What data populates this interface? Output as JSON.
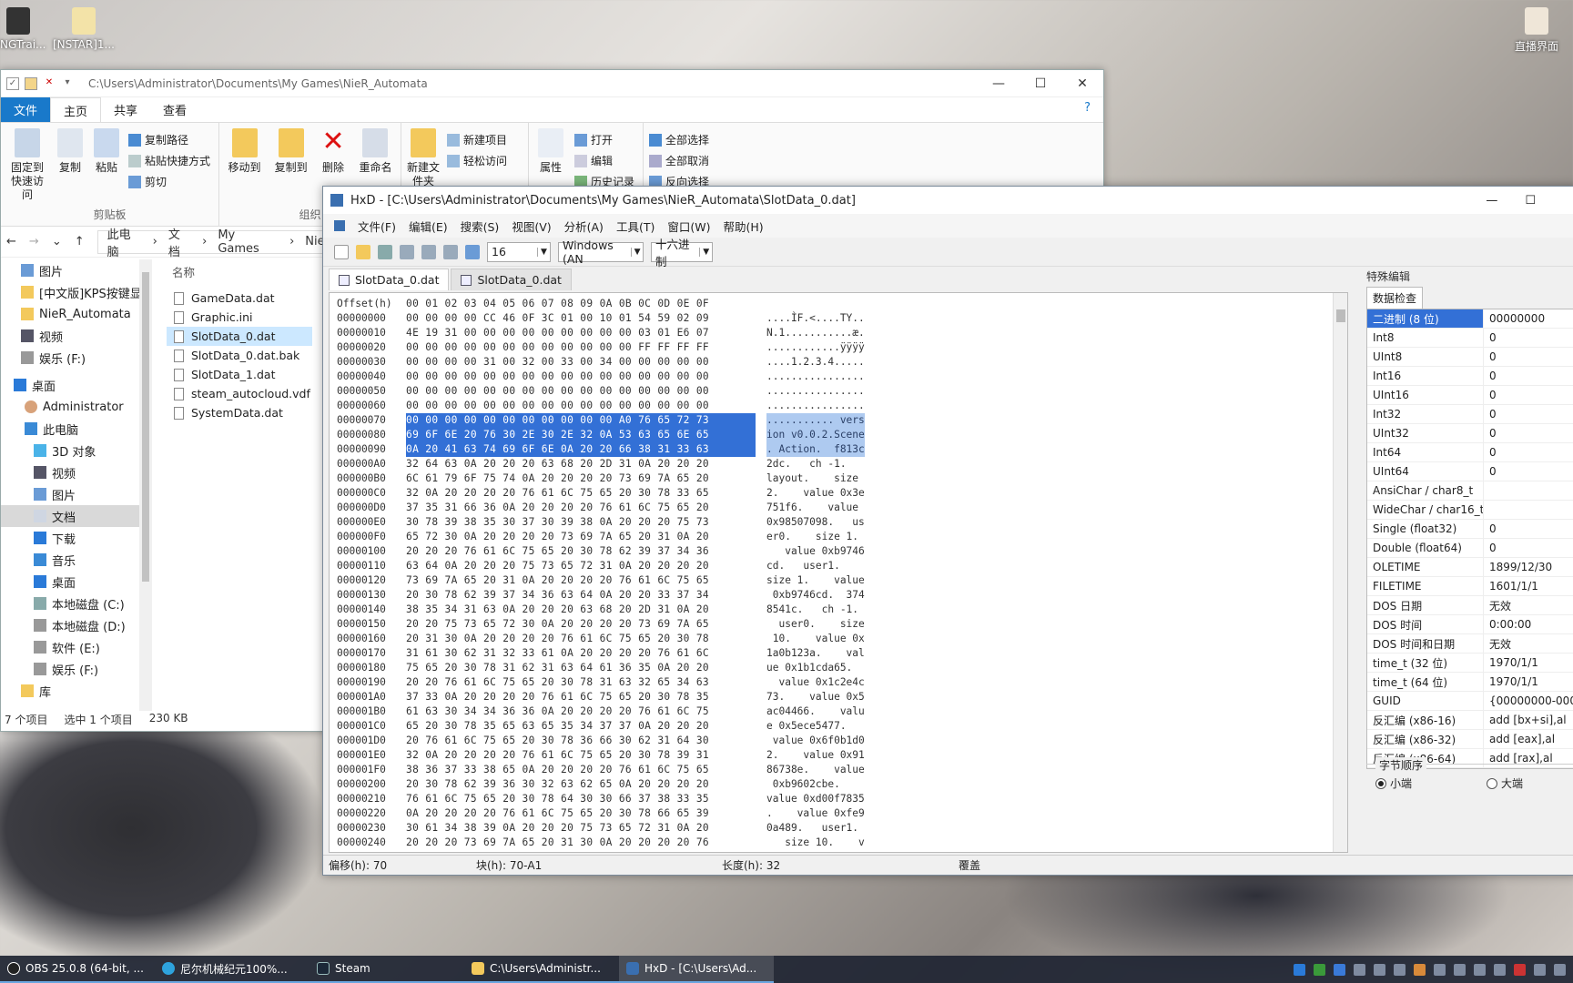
{
  "desktop": {
    "icons": [
      {
        "label": "NGTrai..."
      },
      {
        "label": "[NSTAR]1..."
      },
      {
        "label": "直播界面"
      }
    ]
  },
  "explorer": {
    "path": "C:\\Users\\Administrator\\Documents\\My Games\\NieR_Automata",
    "tabs": [
      "文件",
      "主页",
      "共享",
      "查看"
    ],
    "ribbon": {
      "pin": "固定到快速访问",
      "copy": "复制",
      "paste": "粘贴",
      "copy_path": "复制路径",
      "paste_shortcut": "粘贴快捷方式",
      "cut": "剪切",
      "clipboard_group": "剪贴板",
      "move_to": "移动到",
      "copy_to": "复制到",
      "delete": "删除",
      "rename": "重命名",
      "organize_group": "组织",
      "new_folder": "新建文件夹",
      "new_item": "新建项目",
      "easy_access": "轻松访问",
      "properties": "属性",
      "open": "打开",
      "edit": "编辑",
      "history": "历史记录",
      "select_all": "全部选择",
      "select_none": "全部取消",
      "invert": "反向选择"
    },
    "breadcrumb": [
      "此电脑",
      "文档",
      "My Games",
      "NieR"
    ],
    "nav": [
      "图片",
      "[中文版]KPS按键显示",
      "NieR_Automata",
      "视频",
      "娱乐 (F:)",
      "桌面",
      "Administrator",
      "此电脑",
      "3D 对象",
      "视频",
      "图片",
      "文档",
      "下载",
      "音乐",
      "桌面",
      "本地磁盘 (C:)",
      "本地磁盘 (D:)",
      "软件 (E:)",
      "娱乐 (F:)",
      "库"
    ],
    "column_name": "名称",
    "files": [
      "GameData.dat",
      "Graphic.ini",
      "SlotData_0.dat",
      "SlotData_0.dat.bak",
      "SlotData_1.dat",
      "steam_autocloud.vdf",
      "SystemData.dat"
    ],
    "status": {
      "count": "7 个项目",
      "selected": "选中 1 个项目",
      "size": "230 KB"
    }
  },
  "hxd": {
    "title": "HxD - [C:\\Users\\Administrator\\Documents\\My Games\\NieR_Automata\\SlotData_0.dat]",
    "menu": [
      "文件(F)",
      "编辑(E)",
      "搜索(S)",
      "视图(V)",
      "分析(A)",
      "工具(T)",
      "窗口(W)",
      "帮助(H)"
    ],
    "bytes_per_row": "16",
    "charset": "Windows (AN",
    "base": "十六进制",
    "doc_tabs": [
      "SlotData_0.dat",
      "SlotData_0.dat"
    ],
    "header": {
      "offset": "Offset(h)",
      "cols": "00 01 02 03 04 05 06 07 08 09 0A 0B 0C 0D 0E 0F"
    },
    "rows": [
      [
        "00000000",
        "00 00 00 00 CC 46 0F 3C 01 00 10 01 54 59 02 09",
        "....ÌF.<....TY.."
      ],
      [
        "00000010",
        "4E 19 31 00 00 00 00 00 00 00 00 00 03 01 E6 07",
        "N.1...........æ."
      ],
      [
        "00000020",
        "00 00 00 00 00 00 00 00 00 00 00 00 FF FF FF FF",
        "............ÿÿÿÿ"
      ],
      [
        "00000030",
        "00 00 00 00 31 00 32 00 33 00 34 00 00 00 00 00",
        "....1.2.3.4....."
      ],
      [
        "00000040",
        "00 00 00 00 00 00 00 00 00 00 00 00 00 00 00 00",
        "................"
      ],
      [
        "00000050",
        "00 00 00 00 00 00 00 00 00 00 00 00 00 00 00 00",
        "................"
      ],
      [
        "00000060",
        "00 00 00 00 00 00 00 00 00 00 00 00 00 00 00 00",
        "................"
      ],
      [
        "00000070",
        "00 00 00 00 00 00 00 00 00 00 00 A0 76 65 72 73",
        "........... vers"
      ],
      [
        "00000080",
        "69 6F 6E 20 76 30 2E 30 2E 32 0A 53 63 65 6E 65",
        "ion v0.0.2.Scene"
      ],
      [
        "00000090",
        "0A 20 41 63 74 69 6F 6E 0A 20 20 66 38 31 33 63",
        ". Action.  f813c"
      ],
      [
        "000000A0",
        "32 64 63 0A 20 20 20 63 68 20 2D 31 0A 20 20 20",
        "2dc.   ch -1.   "
      ],
      [
        "000000B0",
        "6C 61 79 6F 75 74 0A 20 20 20 20 73 69 7A 65 20",
        "layout.    size "
      ],
      [
        "000000C0",
        "32 0A 20 20 20 20 76 61 6C 75 65 20 30 78 33 65",
        "2.    value 0x3e"
      ],
      [
        "000000D0",
        "37 35 31 66 36 0A 20 20 20 20 76 61 6C 75 65 20",
        "751f6.    value "
      ],
      [
        "000000E0",
        "30 78 39 38 35 30 37 30 39 38 0A 20 20 20 75 73",
        "0x98507098.   us"
      ],
      [
        "000000F0",
        "65 72 30 0A 20 20 20 20 73 69 7A 65 20 31 0A 20",
        "er0.    size 1. "
      ],
      [
        "00000100",
        "20 20 20 76 61 6C 75 65 20 30 78 62 39 37 34 36",
        "   value 0xb9746"
      ],
      [
        "00000110",
        "63 64 0A 20 20 20 75 73 65 72 31 0A 20 20 20 20",
        "cd.   user1.    "
      ],
      [
        "00000120",
        "73 69 7A 65 20 31 0A 20 20 20 20 76 61 6C 75 65",
        "size 1.    value"
      ],
      [
        "00000130",
        "20 30 78 62 39 37 34 36 63 64 0A 20 20 33 37 34",
        " 0xb9746cd.  374"
      ],
      [
        "00000140",
        "38 35 34 31 63 0A 20 20 20 63 68 20 2D 31 0A 20",
        "8541c.   ch -1. "
      ],
      [
        "00000150",
        "20 20 75 73 65 72 30 0A 20 20 20 20 73 69 7A 65",
        "  user0.    size"
      ],
      [
        "00000160",
        "20 31 30 0A 20 20 20 20 76 61 6C 75 65 20 30 78",
        " 10.    value 0x"
      ],
      [
        "00000170",
        "31 61 30 62 31 32 33 61 0A 20 20 20 20 76 61 6C",
        "1a0b123a.    val"
      ],
      [
        "00000180",
        "75 65 20 30 78 31 62 31 63 64 61 36 35 0A 20 20",
        "ue 0x1b1cda65.  "
      ],
      [
        "00000190",
        "20 20 76 61 6C 75 65 20 30 78 31 63 32 65 34 63",
        "  value 0x1c2e4c"
      ],
      [
        "000001A0",
        "37 33 0A 20 20 20 20 76 61 6C 75 65 20 30 78 35",
        "73.    value 0x5"
      ],
      [
        "000001B0",
        "61 63 30 34 34 36 36 0A 20 20 20 20 76 61 6C 75",
        "ac04466.    valu"
      ],
      [
        "000001C0",
        "65 20 30 78 35 65 63 65 35 34 37 37 0A 20 20 20",
        "e 0x5ece5477.   "
      ],
      [
        "000001D0",
        "20 76 61 6C 75 65 20 30 78 36 66 30 62 31 64 30",
        " value 0x6f0b1d0"
      ],
      [
        "000001E0",
        "32 0A 20 20 20 20 76 61 6C 75 65 20 30 78 39 31",
        "2.    value 0x91"
      ],
      [
        "000001F0",
        "38 36 37 33 38 65 0A 20 20 20 20 76 61 6C 75 65",
        "86738e.    value"
      ],
      [
        "00000200",
        "20 30 78 62 39 36 30 32 63 62 65 0A 20 20 20 20",
        " 0xb9602cbe.    "
      ],
      [
        "00000210",
        "76 61 6C 75 65 20 30 78 64 30 30 66 37 38 33 35",
        "value 0xd00f7835"
      ],
      [
        "00000220",
        "0A 20 20 20 20 76 61 6C 75 65 20 30 78 66 65 39",
        ".    value 0xfe9"
      ],
      [
        "00000230",
        "30 61 34 38 39 0A 20 20 20 75 73 65 72 31 0A 20",
        "0a489.   user1. "
      ],
      [
        "00000240",
        "20 20 20 73 69 7A 65 20 31 30 0A 20 20 20 20 76",
        "   size 10.    v"
      ]
    ],
    "status": {
      "offset": "偏移(h): 70",
      "block": "块(h): 70-A1",
      "length": "长度(h): 32",
      "mode": "覆盖"
    },
    "inspector": {
      "title": "特殊编辑",
      "tab": "数据检查",
      "rows": [
        [
          "二进制 (8 位)",
          "00000000"
        ],
        [
          "Int8",
          "0"
        ],
        [
          "UInt8",
          "0"
        ],
        [
          "Int16",
          "0"
        ],
        [
          "UInt16",
          "0"
        ],
        [
          "Int32",
          "0"
        ],
        [
          "UInt32",
          "0"
        ],
        [
          "Int64",
          "0"
        ],
        [
          "UInt64",
          "0"
        ],
        [
          "AnsiChar / char8_t",
          ""
        ],
        [
          "WideChar / char16_t",
          ""
        ],
        [
          "Single (float32)",
          "0"
        ],
        [
          "Double (float64)",
          "0"
        ],
        [
          "OLETIME",
          "1899/12/30"
        ],
        [
          "FILETIME",
          "1601/1/1"
        ],
        [
          "DOS 日期",
          "无效"
        ],
        [
          "DOS 时间",
          "0:00:00"
        ],
        [
          "DOS 时间和日期",
          "无效"
        ],
        [
          "time_t (32 位)",
          "1970/1/1"
        ],
        [
          "time_t (64 位)",
          "1970/1/1"
        ],
        [
          "GUID",
          "{00000000-000"
        ],
        [
          "反汇编 (x86-16)",
          "add [bx+si],al"
        ],
        [
          "反汇编 (x86-32)",
          "add [eax],al"
        ],
        [
          "反汇编 (x86-64)",
          "add [rax],al"
        ]
      ],
      "byte_order": "字节顺序",
      "little": "小端",
      "big": "大端"
    }
  },
  "taskbar": {
    "apps": [
      "OBS 25.0.8 (64-bit, ...",
      "尼尔机械纪元100%...",
      "Steam",
      "C:\\Users\\Administr...",
      "HxD - [C:\\Users\\Ad..."
    ]
  },
  "colors": {
    "accent": "#1979ca",
    "selection": "#3370d6"
  }
}
